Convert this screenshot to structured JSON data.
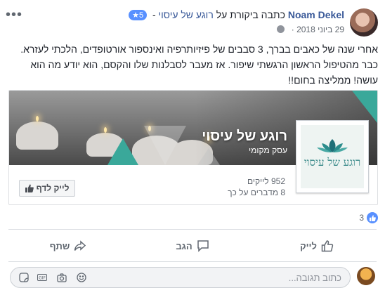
{
  "post": {
    "author": "Noam Dekel",
    "action_text": "כתבה ביקורת על",
    "page_name": "רוגע של עיסוי",
    "separator": "-",
    "rating": "5",
    "rating_star": "★",
    "date": "29 ביוני 2018",
    "date_separator": "·",
    "more_label": "•••",
    "body": "אחרי שנה של כאבים בברך, 3 סבבים של פיזיותרפיה ואינספור אורטופדים, הלכתי לעזרא. כבר מהטיפול הראשון הרגשתי שיפור. אז מעבר לסבלנות שלו והקסם, הוא יודע מה הוא עושה! ממליצה בחום!!"
  },
  "card": {
    "title": "רוגע של עיסוי",
    "category": "עסק מקומי",
    "logo_text": "רוגע של עיסוי",
    "likes": "952 לייקים",
    "talking": "8 מדברים על כך",
    "like_button": "לייק לדף"
  },
  "reactions": {
    "count": "3"
  },
  "actions": {
    "like": "לייק",
    "comment": "הגב",
    "share": "שתף"
  },
  "comment": {
    "placeholder": "כתוב תגובה..."
  },
  "colors": {
    "link": "#385898",
    "accent": "#5890ff",
    "teal": "#3aa89a"
  },
  "icons": [
    "more-icon",
    "globe-icon",
    "like-icon",
    "comment-icon",
    "share-icon",
    "lotus-icon",
    "emoji-icon",
    "camera-icon",
    "gif-icon",
    "sticker-icon"
  ]
}
